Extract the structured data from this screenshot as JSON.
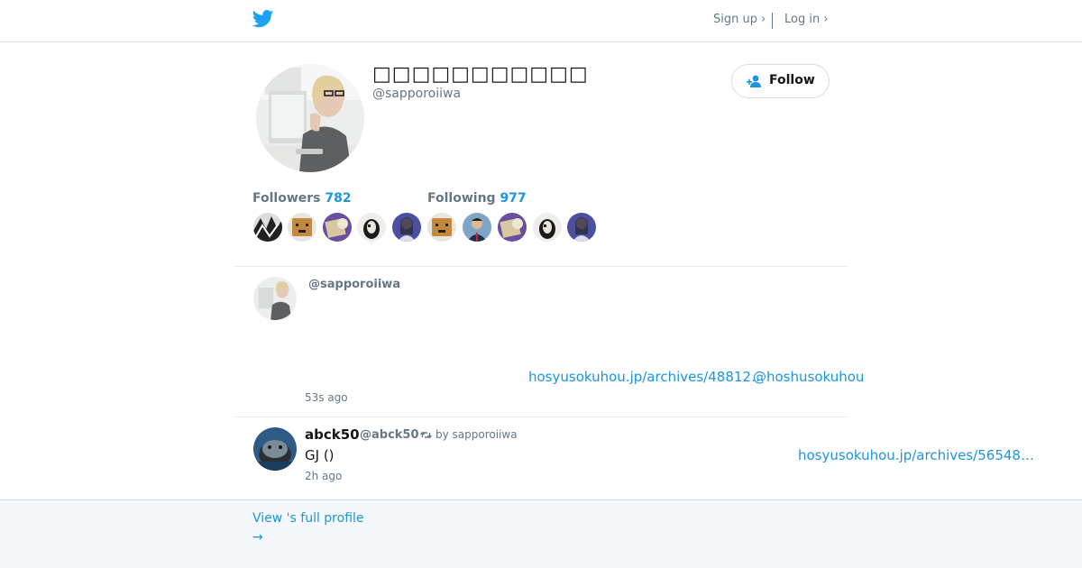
{
  "header": {
    "logo_icon": "twitter-bird-icon",
    "brand_color": "#1da1f2",
    "signup_label": "Sign up ›",
    "login_label": "Log in ›"
  },
  "profile": {
    "display_name": "□□□□□□□□□□□",
    "screen_name": "@sapporoiiwa",
    "follow_label": "Follow",
    "follow_icon": "add-person-icon"
  },
  "stats": {
    "followers_label": "Followers",
    "followers_count": "782",
    "following_label": "Following",
    "following_count": "977"
  },
  "tweets": [
    {
      "screen_name": "@sapporoiiwa",
      "link_text": "hosyusokuhou.jp/archives/48812…",
      "mention": "@hoshusokuhou",
      "timestamp": "53s ago"
    },
    {
      "name": "abck50",
      "screen_name": "@abck50",
      "retweet_icon": "retweet-icon",
      "retweeted_by": "by sapporoiiwa",
      "text": "GJ ()",
      "link_text": "hosyusokuhou.jp/archives/56548…",
      "timestamp": "2h ago"
    }
  ],
  "footer": {
    "full_profile_label": "View 's full profile",
    "arrow": "→"
  },
  "colors": {
    "link": "#1b95e0",
    "muted": "#657786",
    "footer_bg": "#f5f8fa"
  }
}
